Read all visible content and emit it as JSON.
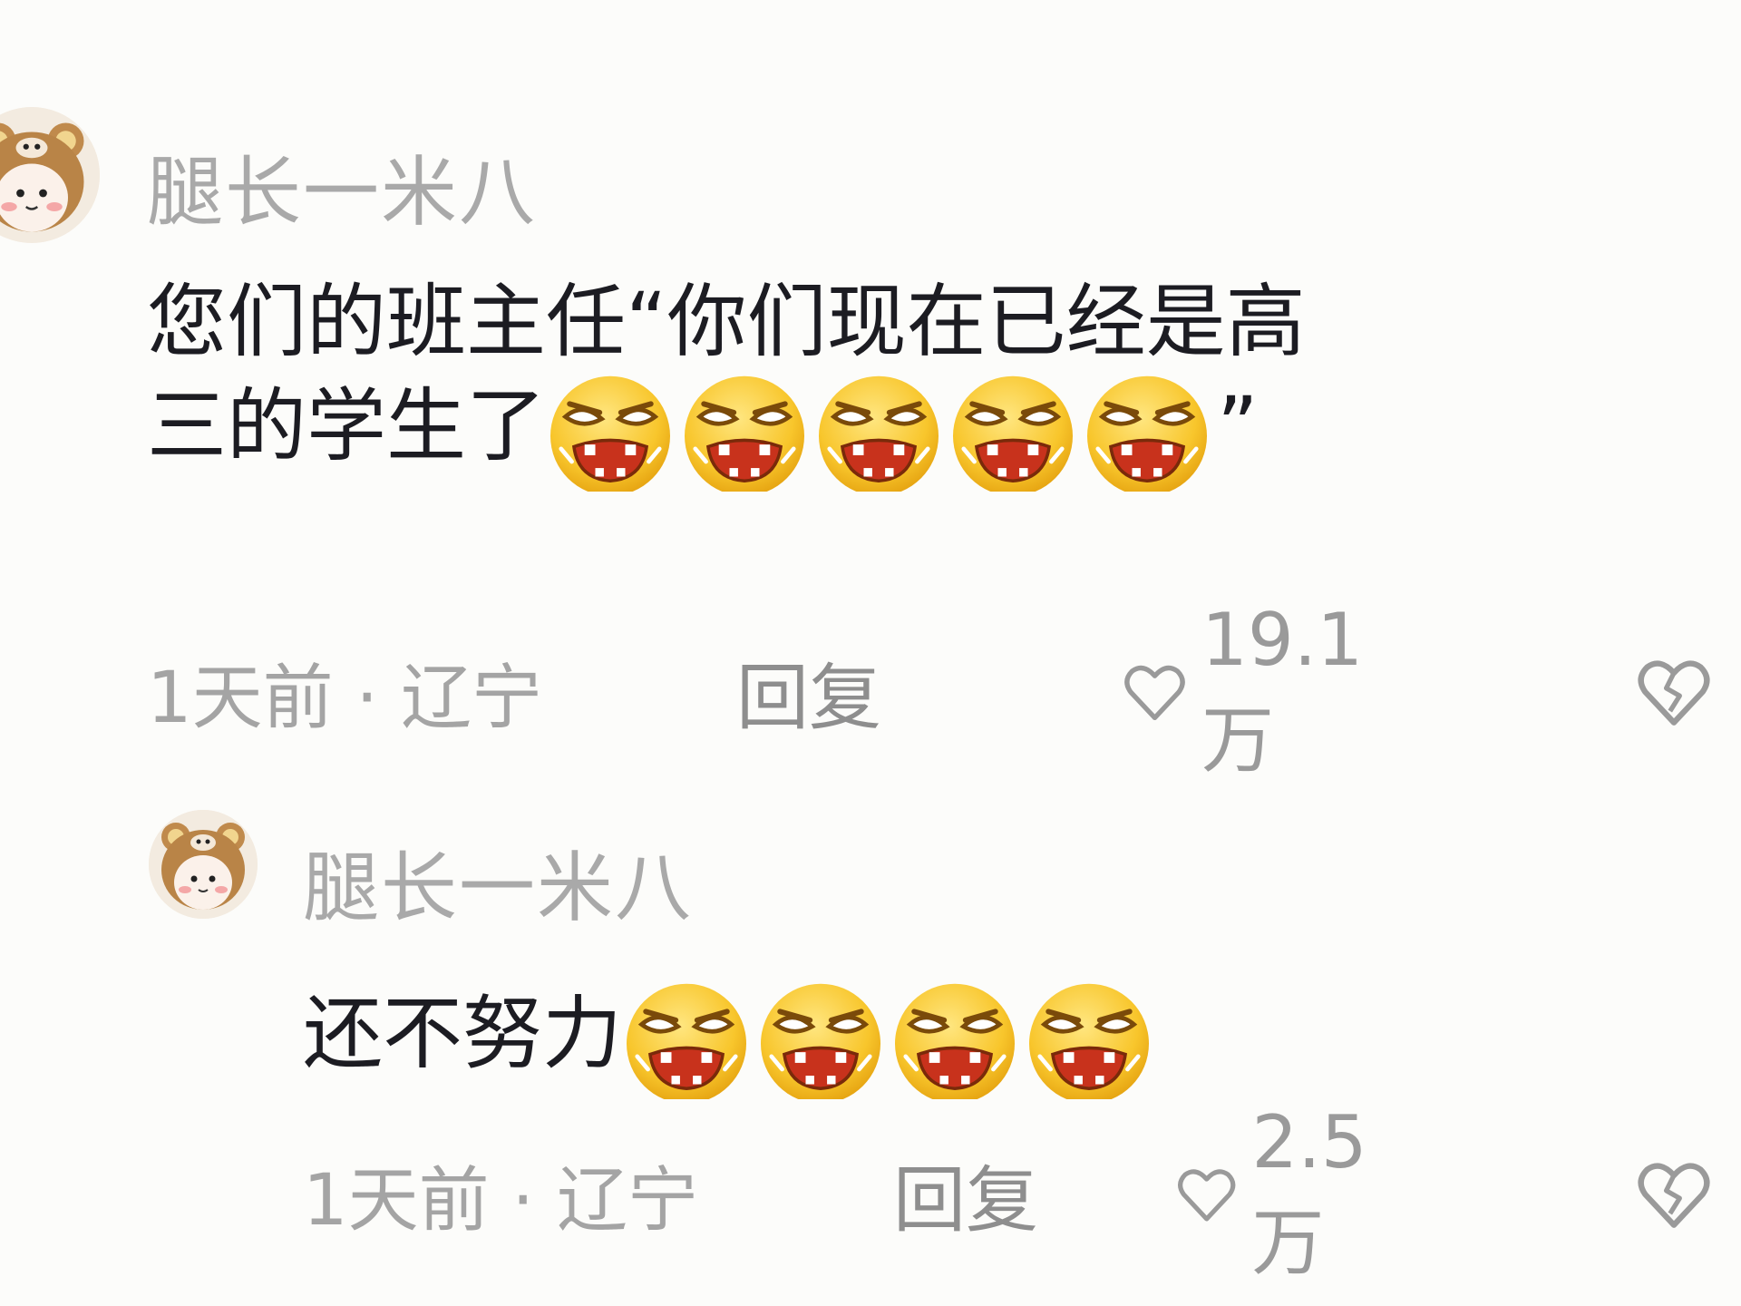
{
  "comments": [
    {
      "username": "腿长一米八",
      "text_line1": "您们的班主任“你们现在已经是高",
      "text_line2": "三的学生了",
      "text_close_quote": "”",
      "emoji_count": 5,
      "emoji_name": "angry-laugh-emoji",
      "time_location": "1天前 · 辽宁",
      "reply_label": "回复",
      "like_count": "19.1万"
    },
    {
      "username": "腿长一米八",
      "text_line1": "还不努力",
      "emoji_count": 4,
      "emoji_name": "angry-laugh-emoji",
      "time_location": "1天前 · 辽宁",
      "reply_label": "回复",
      "like_count": "2.5万"
    }
  ],
  "icons": {
    "like": "heart-outline-icon",
    "dislike": "broken-heart-icon"
  },
  "colors": {
    "background": "#fcfcfa",
    "username": "#a9a9a9",
    "content": "#1c1c22",
    "meta": "#a4a4a4",
    "emoji_face": "#f6c12a"
  }
}
